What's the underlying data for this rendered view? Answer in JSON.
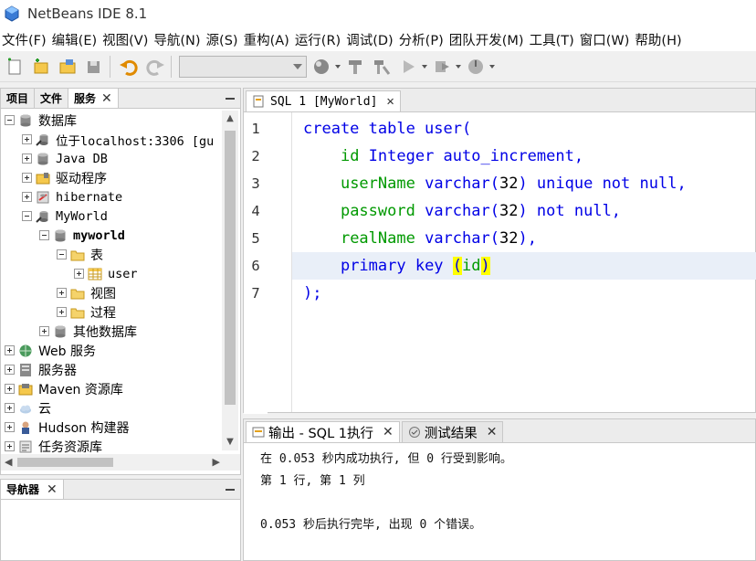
{
  "window": {
    "title": "NetBeans IDE 8.1"
  },
  "menu": [
    "文件(F)",
    "编辑(E)",
    "视图(V)",
    "导航(N)",
    "源(S)",
    "重构(A)",
    "运行(R)",
    "调试(D)",
    "分析(P)",
    "团队开发(M)",
    "工具(T)",
    "窗口(W)",
    "帮助(H)"
  ],
  "toolbar": {
    "config_value": ""
  },
  "left_tabs": [
    {
      "label": "项目",
      "active": false
    },
    {
      "label": "文件",
      "active": false
    },
    {
      "label": "服务",
      "active": true
    }
  ],
  "tree": [
    {
      "label": "数据库",
      "level": 0,
      "expander": "minus",
      "icon": "database-icon"
    },
    {
      "label": "位于localhost:3306 [gu",
      "level": 1,
      "expander": "plus",
      "icon": "connection-icon",
      "mono": true
    },
    {
      "label": "Java DB",
      "level": 1,
      "expander": "plus",
      "icon": "database-icon",
      "mono": true
    },
    {
      "label": "驱动程序",
      "level": 1,
      "expander": "plus",
      "icon": "driver-folder-icon"
    },
    {
      "label": "hibernate",
      "level": 1,
      "expander": "plus",
      "icon": "broken-connection-icon",
      "mono": true
    },
    {
      "label": "MyWorld",
      "level": 1,
      "expander": "minus",
      "icon": "connection-icon",
      "mono": true
    },
    {
      "label": "myworld",
      "level": 2,
      "expander": "minus",
      "icon": "schema-icon",
      "mono": true,
      "bold": true
    },
    {
      "label": "表",
      "level": 3,
      "expander": "minus",
      "icon": "folder-icon"
    },
    {
      "label": "user",
      "level": 4,
      "expander": "plus",
      "icon": "table-icon",
      "mono": true
    },
    {
      "label": "视图",
      "level": 3,
      "expander": "plus",
      "icon": "folder-icon"
    },
    {
      "label": "过程",
      "level": 3,
      "expander": "plus",
      "icon": "folder-icon"
    },
    {
      "label": "其他数据库",
      "level": 2,
      "expander": "plus",
      "icon": "database-icon"
    },
    {
      "label": "Web 服务",
      "level": 0,
      "expander": "plus",
      "icon": "globe-icon"
    },
    {
      "label": "服务器",
      "level": 0,
      "expander": "plus",
      "icon": "server-icon"
    },
    {
      "label": "Maven 资源库",
      "level": 0,
      "expander": "plus",
      "icon": "maven-icon"
    },
    {
      "label": "云",
      "level": 0,
      "expander": "plus",
      "icon": "cloud-icon"
    },
    {
      "label": "Hudson 构建器",
      "level": 0,
      "expander": "plus",
      "icon": "hudson-icon"
    },
    {
      "label": "任务资源库",
      "level": 0,
      "expander": "plus",
      "icon": "task-icon"
    }
  ],
  "navigator": {
    "label": "导航器"
  },
  "editor": {
    "tab": "SQL 1 [MyWorld]",
    "current_line": 6,
    "lines": [
      [
        {
          "t": "create table user(",
          "c": "kw"
        }
      ],
      [
        {
          "t": "    ",
          "c": ""
        },
        {
          "t": "id",
          "c": "id"
        },
        {
          "t": " Integer auto_increment,",
          "c": "kw"
        }
      ],
      [
        {
          "t": "    ",
          "c": ""
        },
        {
          "t": "userName",
          "c": "id"
        },
        {
          "t": " varchar(",
          "c": "kw"
        },
        {
          "t": "32",
          "c": "num"
        },
        {
          "t": ") unique not null,",
          "c": "kw"
        }
      ],
      [
        {
          "t": "    ",
          "c": ""
        },
        {
          "t": "password",
          "c": "id"
        },
        {
          "t": " varchar(",
          "c": "kw"
        },
        {
          "t": "32",
          "c": "num"
        },
        {
          "t": ") not null,",
          "c": "kw"
        }
      ],
      [
        {
          "t": "    ",
          "c": ""
        },
        {
          "t": "realName",
          "c": "id"
        },
        {
          "t": " varchar(",
          "c": "kw"
        },
        {
          "t": "32",
          "c": "num"
        },
        {
          "t": "),",
          "c": "kw"
        }
      ],
      [
        {
          "t": "    ",
          "c": ""
        },
        {
          "t": "primary key ",
          "c": "kw"
        },
        {
          "t": "(",
          "c": "kw hl"
        },
        {
          "t": "id",
          "c": "id"
        },
        {
          "t": ")",
          "c": "kw hl"
        }
      ],
      [
        {
          "t": ");",
          "c": "kw"
        }
      ]
    ]
  },
  "output": {
    "tabs": [
      {
        "label": "输出 - SQL 1执行",
        "active": true
      },
      {
        "label": "测试结果",
        "active": false
      }
    ],
    "lines": [
      "在 0.053 秒内成功执行, 但 0 行受到影响。",
      "第 1 行, 第 1 列",
      "",
      "0.053 秒后执行完毕, 出现 0 个错误。"
    ]
  },
  "colors": {
    "keyword": "#0000e6",
    "identifier": "#009900",
    "bracket_highlight": "#ffff00",
    "current_line": "#e9eff8"
  }
}
